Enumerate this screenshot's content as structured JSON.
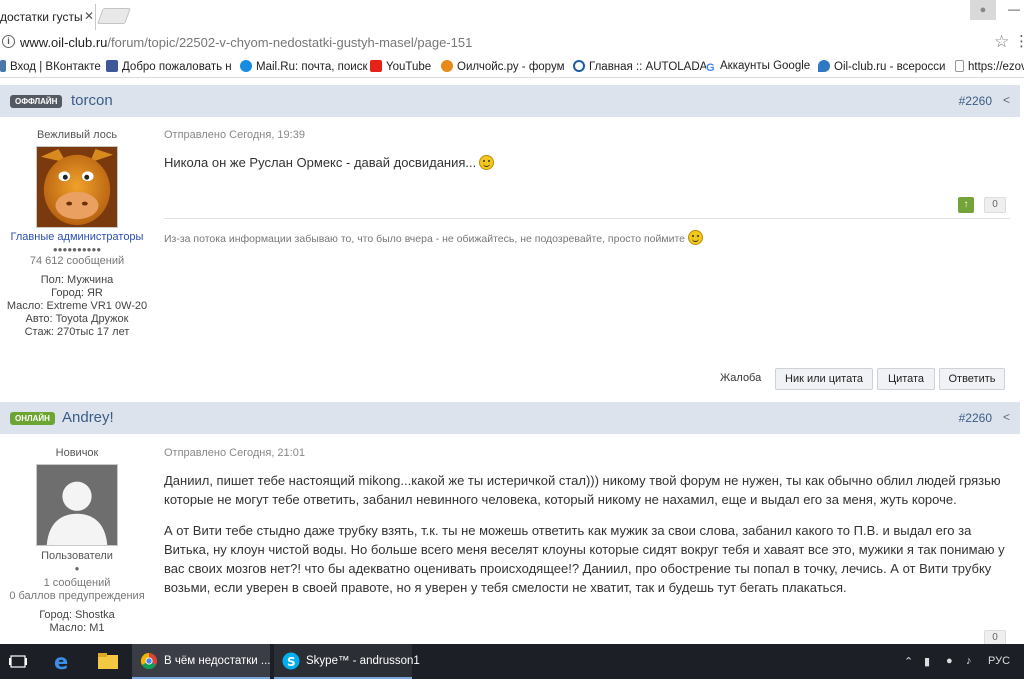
{
  "browser": {
    "tab_title": "достатки густы",
    "tab_close": "✕",
    "profile_icon": "person-icon",
    "url_domain": "www.oil-club.ru",
    "url_path": "/forum/topic/22502-v-chyom-nedostatki-gustyh-masel/page-151",
    "bookmarks": [
      {
        "label": "Вход | ВКонтакте",
        "icon": "vk-icon",
        "color": "#4a76a8"
      },
      {
        "label": "Добро пожаловать н",
        "icon": "facebook-icon",
        "color": "#3b5998"
      },
      {
        "label": "Mail.Ru: почта, поиск",
        "icon": "mailru-icon",
        "color": "#168de2"
      },
      {
        "label": "YouTube",
        "icon": "youtube-icon",
        "color": "#e62117"
      },
      {
        "label": "Оилчойс.ру - форум",
        "icon": "oilchoice-icon",
        "color": "#e88a1a"
      },
      {
        "label": "Главная :: AUTOLADA",
        "icon": "autolada-icon",
        "color": "#1b5aa8"
      },
      {
        "label": "Аккаунты Google",
        "icon": "google-icon",
        "color": "#4285f4"
      },
      {
        "label": "Oil-club.ru - всеросси",
        "icon": "oilclub-icon",
        "color": "#2f78c4"
      },
      {
        "label": "https://ezov",
        "icon": "page-icon",
        "color": "#cccccc"
      }
    ]
  },
  "posts": [
    {
      "status": "ОФФЛАЙН",
      "status_color": "#555a62",
      "author": "torcon",
      "number": "#2260",
      "rank": "Вежливый лось",
      "group": "Главные администраторы",
      "pips": "●●●●●●●●●●",
      "message_count": "74  612 сообщений",
      "fields": [
        "Пол: Мужчина",
        "Город: ЯR",
        "Масло: Extreme VR1 0W-20",
        "Авто: Toyota Дружок",
        "Стаж: 270тыс 17 лет"
      ],
      "posted": "Отправлено Сегодня, 19:39",
      "text": "Никола он же Руслан Ормекс - давай досвидания...",
      "reputation": "0",
      "signature": "Из-за потока информации забываю то, что было вчера - не обижайтесь, не подозревайте, просто поймите",
      "actions": {
        "report": "Жалоба",
        "nick_quote": "Ник или цитата",
        "quote": "Цитата",
        "reply": "Ответить"
      }
    },
    {
      "status": "ОНЛАЙН",
      "status_color": "#6ca531",
      "author": "Andrey!",
      "number": "#2260",
      "rank": "Новичок",
      "group": "Пользователи",
      "pips": "●",
      "message_count": "1 сообщений",
      "warnings": "0 баллов предупреждения",
      "fields": [
        "Город: Shostka",
        "Масло: M1"
      ],
      "posted": "Отправлено Сегодня, 21:01",
      "paragraph1": "Даниил, пишет тебе настоящий mikong...какой же ты истеричкой стал))) никому твой форум не нужен, ты как обычно облил людей грязью которые не могут тебе ответить, забанил невинного человека, который никому не нахамил, еще и выдал его за меня, жуть короче.",
      "paragraph2": "А от Вити тебе стыдно даже трубку взять, т.к. ты не можешь ответить как мужик за свои слова, забанил какого то П.В. и выдал его за Витька, ну клоун чистой воды. Но больше всего меня веселят клоуны которые сидят вокруг тебя и хаваят все это, мужики я так понимаю у вас своих мозгов нет?! что бы адекватно оценивать происходящее!? Даниил, про обострение ты попал в точку, лечись. А от Вити трубку возьми, если уверен в своей правоте, но я уверен у тебя смелости не хватит, так и будешь тут бегать плакаться.",
      "reputation": "0"
    }
  ],
  "taskbar": {
    "chrome_label": "В чём недостатки ...",
    "skype_label": "Skype™ - andrusson1",
    "language": "РУС"
  }
}
